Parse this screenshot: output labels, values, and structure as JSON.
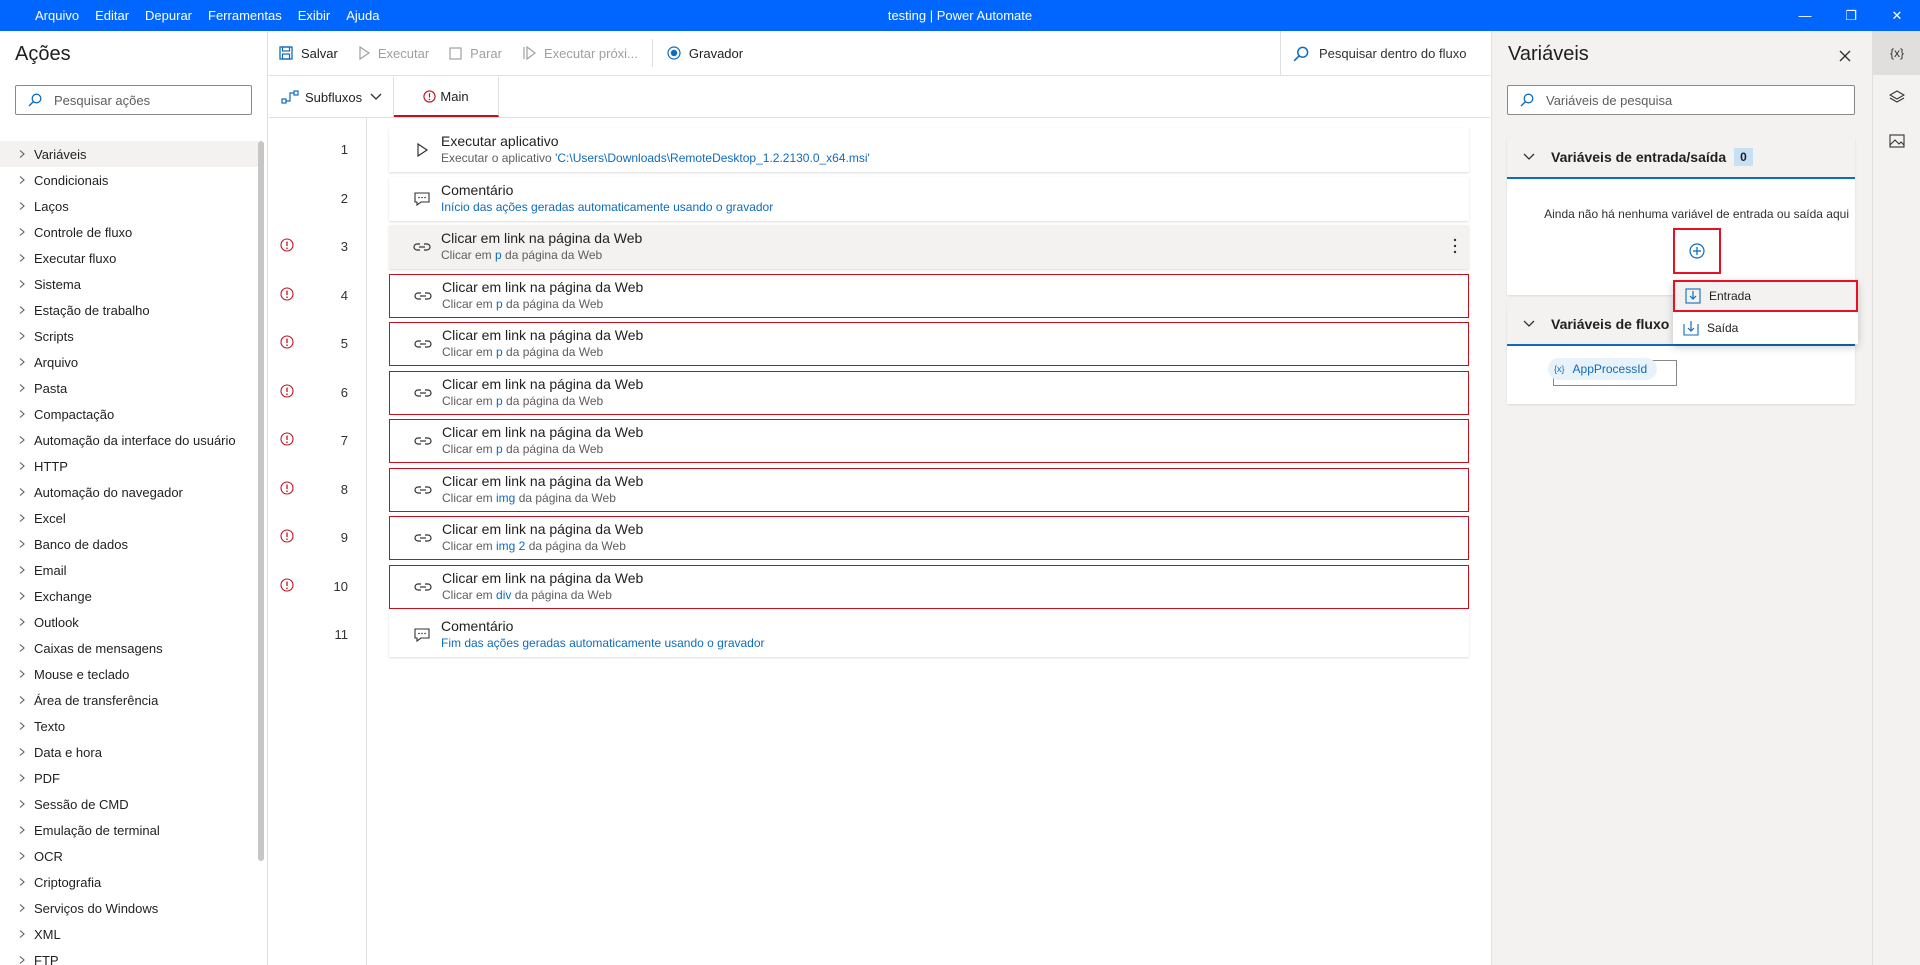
{
  "menu": [
    "Arquivo",
    "Editar",
    "Depurar",
    "Ferramentas",
    "Exibir",
    "Ajuda"
  ],
  "window_title": "testing | Power Automate",
  "actions_panel": {
    "title": "Ações",
    "search_placeholder": "Pesquisar ações",
    "categories": [
      "Variáveis",
      "Condicionais",
      "Laços",
      "Controle de fluxo",
      "Executar fluxo",
      "Sistema",
      "Estação de trabalho",
      "Scripts",
      "Arquivo",
      "Pasta",
      "Compactação",
      "Automação da interface do usuário",
      "HTTP",
      "Automação do navegador",
      "Excel",
      "Banco de dados",
      "Email",
      "Exchange",
      "Outlook",
      "Caixas de mensagens",
      "Mouse e teclado",
      "Área de transferência",
      "Texto",
      "Data e hora",
      "PDF",
      "Sessão de CMD",
      "Emulação de terminal",
      "OCR",
      "Criptografia",
      "Serviços do Windows",
      "XML",
      "FTP"
    ]
  },
  "toolbar": {
    "save": "Salvar",
    "run": "Executar",
    "stop": "Parar",
    "run_next": "Executar próxi...",
    "recorder": "Gravador",
    "search": "Pesquisar dentro do fluxo"
  },
  "tabs": {
    "subflows": "Subfluxos",
    "main": "Main"
  },
  "steps": [
    {
      "n": "1",
      "title": "Executar aplicativo",
      "pre": "Executar o aplicativo ",
      "link": "'C:\\Users\\Downloads\\RemoteDesktop_1.2.2130.0_x64.msi'",
      "post": "",
      "kind": "run",
      "error": false
    },
    {
      "n": "2",
      "title": "Comentário",
      "pre": "",
      "link": "Início das ações geradas automaticamente usando o gravador",
      "post": "",
      "kind": "comment",
      "error": false
    },
    {
      "n": "3",
      "title": "Clicar em link na página da Web",
      "pre": "Clicar em ",
      "link": "p",
      "post": " da página da Web",
      "kind": "link",
      "error": true
    },
    {
      "n": "4",
      "title": "Clicar em link na página da Web",
      "pre": "Clicar em ",
      "link": "p",
      "post": " da página da Web",
      "kind": "link",
      "error": true
    },
    {
      "n": "5",
      "title": "Clicar em link na página da Web",
      "pre": "Clicar em ",
      "link": "p",
      "post": " da página da Web",
      "kind": "link",
      "error": true
    },
    {
      "n": "6",
      "title": "Clicar em link na página da Web",
      "pre": "Clicar em ",
      "link": "p",
      "post": " da página da Web",
      "kind": "link",
      "error": true
    },
    {
      "n": "7",
      "title": "Clicar em link na página da Web",
      "pre": "Clicar em ",
      "link": "p",
      "post": " da página da Web",
      "kind": "link",
      "error": true
    },
    {
      "n": "8",
      "title": "Clicar em link na página da Web",
      "pre": "Clicar em ",
      "link": "img",
      "post": " da página da Web",
      "kind": "link",
      "error": true
    },
    {
      "n": "9",
      "title": "Clicar em link na página da Web",
      "pre": "Clicar em ",
      "link": "img 2",
      "post": " da página da Web",
      "kind": "link",
      "error": true
    },
    {
      "n": "10",
      "title": "Clicar em link na página da Web",
      "pre": "Clicar em ",
      "link": "div",
      "post": " da página da Web",
      "kind": "link",
      "error": true
    },
    {
      "n": "11",
      "title": "Comentário",
      "pre": "",
      "link": "Fim das ações geradas automaticamente usando o gravador",
      "post": "",
      "kind": "comment",
      "error": false
    }
  ],
  "variables_panel": {
    "title": "Variáveis",
    "search_placeholder": "Variáveis de pesquisa",
    "io_section": {
      "title": "Variáveis de entrada/saída",
      "count": "0",
      "empty_message": "Ainda não há nenhuma variável de entrada ou saída aqui"
    },
    "flow_section": {
      "title": "Variáveis de fluxo",
      "variables": [
        "AppProcessId"
      ],
      "var_prefix": "{x}"
    },
    "add_menu": [
      "Entrada",
      "Saída"
    ]
  },
  "right_strip": {
    "variables_icon": "{x}",
    "layers_icon": "layers-icon",
    "images_icon": "images-icon"
  },
  "colors": {
    "titlebar": "#0066ff",
    "error": "#c50f1f",
    "link": "#0f6cbd",
    "highlight": "#e81123"
  }
}
